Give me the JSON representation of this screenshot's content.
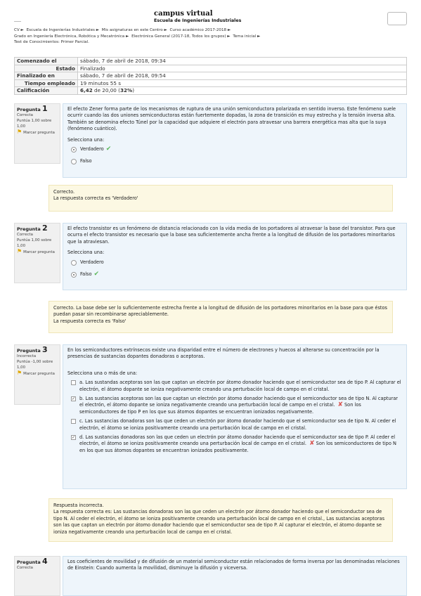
{
  "site": {
    "title": "campus virtual",
    "subtitle": "Escuela de Ingenierías Industriales"
  },
  "breadcrumb": [
    "CV ►",
    "Escuela de Ingenierías Industriales ►",
    "Mis asignaturas en este Centro ►",
    "Curso académico 2017-2018 ►",
    "Grado en Ingeniería Electrónica, Robótica y Mecatrónica ►",
    "Electrónica General (2017-18, Todos los grupos) ►",
    "Tema inicial ►",
    "Test de Conocimientos: Primer Parcial."
  ],
  "summary": {
    "started_label": "Comenzado el",
    "started": "sábado, 7 de abril de 2018, 09:34",
    "state_label": "Estado",
    "state": "Finalizado",
    "finished_label": "Finalizado en",
    "finished": "sábado, 7 de abril de 2018, 09:54",
    "time_label": "Tiempo empleado",
    "time": "19 minutos 55 s",
    "grade_label": "Calificación",
    "grade_score": "6,42",
    "grade_rest": " de 20,00 (",
    "grade_pct": "32%",
    "grade_end": ")"
  },
  "q1": {
    "word": "Pregunta",
    "num": "1",
    "state": "Correcta",
    "mark": "Puntúa 1,00 sobre 1,00",
    "flag": "Marcar pregunta",
    "text": "El efecto Zener forma parte de los mecanismos de ruptura de una unión semiconductora polarizada en sentido inverso. Este fenómeno suele ocurrir cuando las dos uniones semiconductoras están fuertemente dopadas, la zona de transición es muy estrecha y la tensión inversa alta. También se denomina efecto Túnel por la capacidad que adquiere el electrón para atravesar una barrera energética mas alta que la suya (fenómeno cuántico).",
    "prompt": "Selecciona una:",
    "opt1": "Verdadero",
    "opt2": "Falso",
    "fb1": "Correcto.",
    "fb2": "La respuesta correcta es 'Verdadero'"
  },
  "q2": {
    "word": "Pregunta",
    "num": "2",
    "state": "Correcta",
    "mark": "Puntúa 1,00 sobre 1,00",
    "flag": "Marcar pregunta",
    "text": "El efecto transistor es un fenómeno de distancia relacionado con la vida media de los portadores al atravesar la base del transistor. Para que ocurra el efecto transistor es necesario que la base sea suficientemente ancha frente a la longitud de difusión de los portadores minoritarios que la atraviesan.",
    "prompt": "Selecciona una:",
    "opt1": "Verdadero",
    "opt2": "Falso",
    "fb1": "Correcto. La base debe ser lo suficientemente estrecha frente a la longitud de difusión de los portadores minoritarios en la base para que éstos puedan pasar sin recombinarse apreciablemente.",
    "fb2": "La respuesta correcta es 'Falso'"
  },
  "q3": {
    "word": "Pregunta",
    "num": "3",
    "state": "Incorrecta",
    "mark": "Puntúa -1,00 sobre 1,00",
    "flag": "Marcar pregunta",
    "text": "En los semiconductores extrínsecos existe una disparidad entre el número de electrones y huecos al alterarse su concentración por la presencias de sustancias dopantes donadoras o aceptoras.",
    "prompt": "Selecciona una o más de una:",
    "a": "a. Las sustandas aceptoras son las que captan un electrón por átomo donador haciendo que el semiconductor sea de tipo P. Al capturar el electrón, el átomo dopante se ioniza negativamente creando una perturbación local de campo en el cristal.",
    "b": "b. Las sustancias aceptoras son las que captan un electrón por átomo donador haciendo que el semiconductor sea de tipo N. Al capturar el electrón, el átomo dopante se ioniza negativamente creando una perturbación local de campo en el cristal.",
    "b2": "Son los semiconductores de tipo P en los que sus átomos dopantes se encuentran ionizados negativamente.",
    "c": "c. Las sustancias donadoras son las que ceden un electrón por átomo donador haciendo que el semiconductor sea de tipo N. Al ceder el electrón, el átomo se ioniza positivamente creando una perturbación local de campo en el cristal.",
    "d": "d. Las sustancias donadoras son las que ceden un electrón por átomo donador haciendo que el semiconductor sea de tipo P. Al ceder el electrón, el átomo se ioniza positivamente creando una perturbación local de campo en el cristal.",
    "d2": "Son los semiconductores de tipo N en los que sus átomos dopantes se encuentran ionizados positivamente.",
    "fb1": "Respuesta incorrecta.",
    "fb2": "La respuesta correcta es: Las sustancias donadoras son las que ceden un electrón por átomo donador haciendo que el semiconductor sea de tipo N. Al ceder el electrón, el átomo se ioniza positivamente creando una perturbación local de campo en el cristal., Las sustancias aceptoras son las que captan un electrón por átomo donador haciendo que el semiconductor sea de tipo P. Al capturar el electrón, el átomo dopante se ioniza negativamente creando una perturbación local de campo en el cristal."
  },
  "q4": {
    "word": "Pregunta",
    "num": "4",
    "state": "Correcta",
    "text": "Los coeficientes de movilidad y de difusión de un material semiconductor están relacionados de forma inversa por las denominadas relaciones de Einstein: Cuando aumenta la movilidad, disminuye la difusión y viceversa."
  },
  "icons": {
    "check": "✔",
    "cross": "✘",
    "flag": "⚑"
  }
}
